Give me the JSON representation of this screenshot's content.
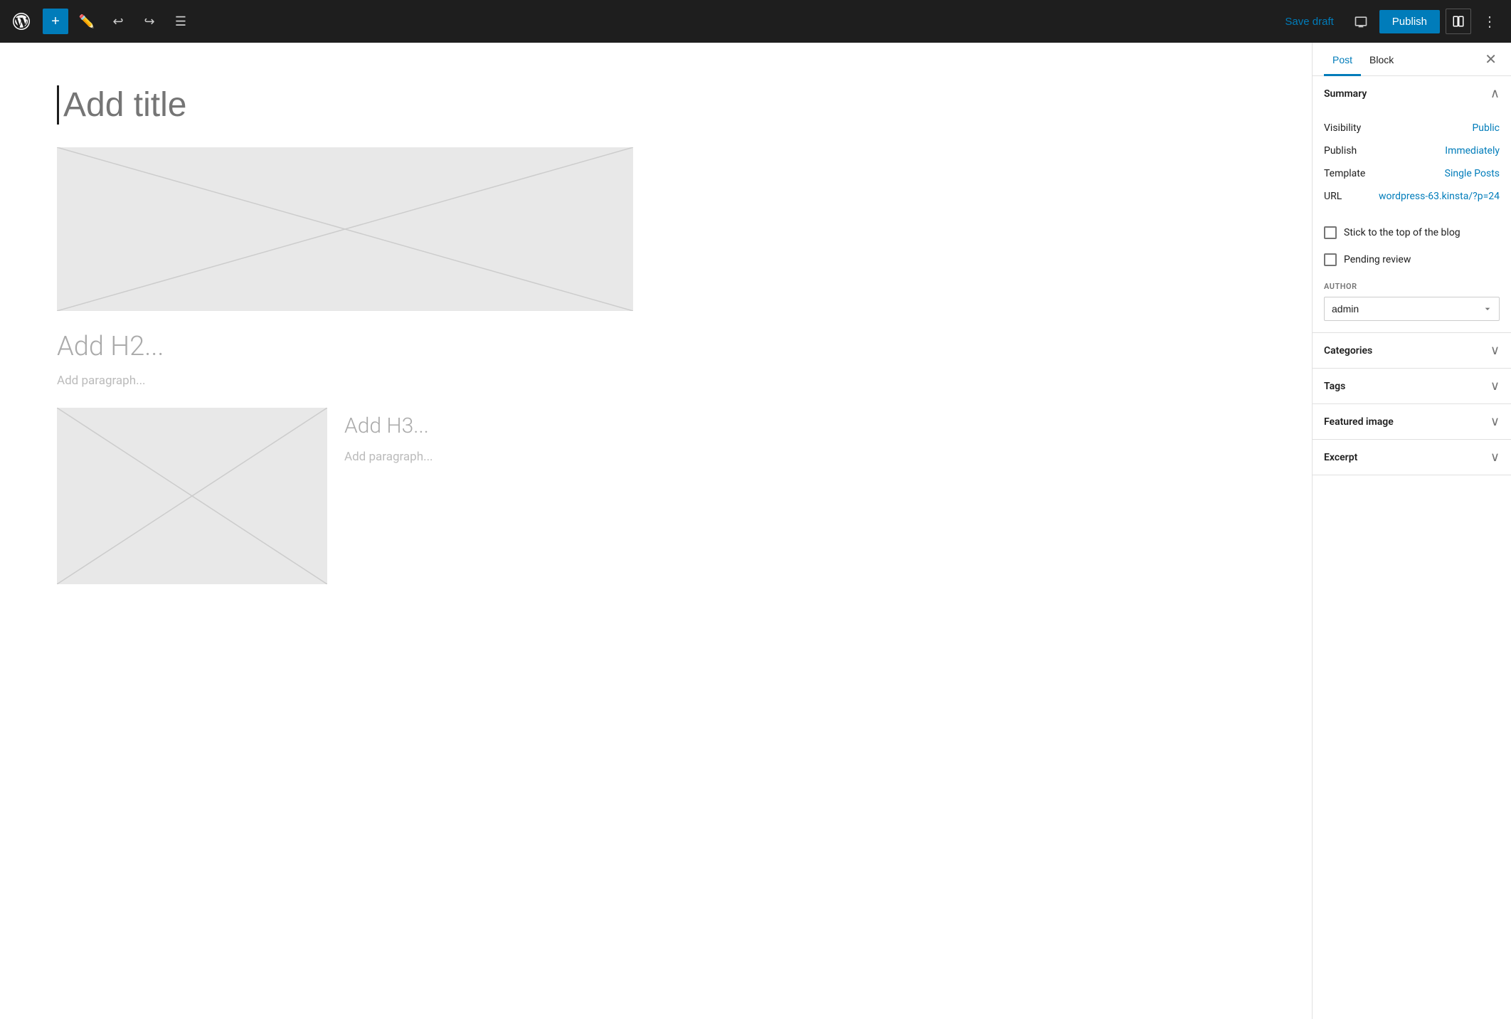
{
  "topbar": {
    "add_label": "+",
    "save_draft_label": "Save draft",
    "publish_label": "Publish"
  },
  "editor": {
    "title_placeholder": "Add title",
    "h2_placeholder": "Add H2...",
    "paragraph_placeholder": "Add paragraph...",
    "h3_placeholder": "Add H3...",
    "paragraph2_placeholder": "Add paragraph..."
  },
  "sidebar": {
    "tab_post": "Post",
    "tab_block": "Block",
    "summary_title": "Summary",
    "visibility_label": "Visibility",
    "visibility_value": "Public",
    "publish_label": "Publish",
    "publish_value": "Immediately",
    "template_label": "Template",
    "template_value": "Single Posts",
    "url_label": "URL",
    "url_value": "wordpress-63.kinsta/?p=24",
    "stick_to_top": "Stick to the top of the blog",
    "pending_review": "Pending review",
    "author_label": "AUTHOR",
    "author_value": "admin",
    "categories_label": "Categories",
    "tags_label": "Tags",
    "featured_image_label": "Featured image",
    "excerpt_label": "Excerpt"
  }
}
